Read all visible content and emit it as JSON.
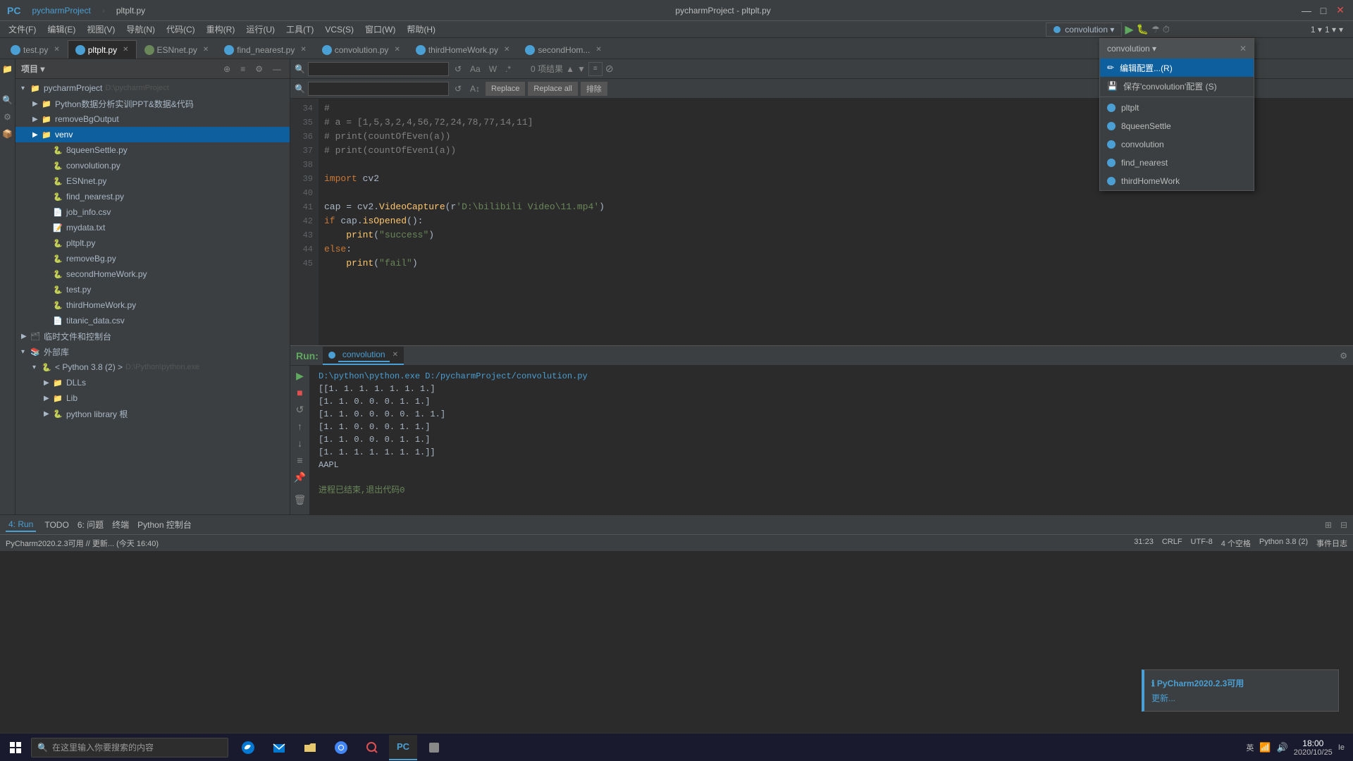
{
  "titlebar": {
    "menu_items": [
      "文件(F)",
      "编辑(E)",
      "视图(V)",
      "导航(N)",
      "代码(C)",
      "重构(R)",
      "运行(U)",
      "工具(T)",
      "VCS(S)",
      "窗口(W)",
      "帮助(H)"
    ],
    "title": "pycharmProject - pltplt.py",
    "btn_min": "—",
    "btn_max": "□",
    "btn_close": "✕"
  },
  "tabs": [
    {
      "label": "test.py",
      "active": false
    },
    {
      "label": "pltplt.py",
      "active": true
    },
    {
      "label": "ESNnet.py",
      "active": false
    },
    {
      "label": "find_nearest.py",
      "active": false
    },
    {
      "label": "convolution.py",
      "active": false
    },
    {
      "label": "thirdHomeWork.py",
      "active": false
    },
    {
      "label": "secondHom...",
      "active": false
    }
  ],
  "project": {
    "title": "项目 ▾",
    "root": "pycharmProject",
    "root_path": "D:\\pycharmProject",
    "items": [
      {
        "name": "Python数据分析实训PPT&数据&代码",
        "type": "folder",
        "indent": 1
      },
      {
        "name": "removeBgOutput",
        "type": "folder",
        "indent": 1
      },
      {
        "name": "venv",
        "type": "folder",
        "indent": 1,
        "selected": true
      },
      {
        "name": "8queenSettle.py",
        "type": "py",
        "indent": 2
      },
      {
        "name": "convolution.py",
        "type": "py",
        "indent": 2
      },
      {
        "name": "ESNnet.py",
        "type": "py",
        "indent": 2
      },
      {
        "name": "find_nearest.py",
        "type": "py",
        "indent": 2
      },
      {
        "name": "job_info.csv",
        "type": "csv",
        "indent": 2
      },
      {
        "name": "mydata.txt",
        "type": "txt",
        "indent": 2
      },
      {
        "name": "pltplt.py",
        "type": "py",
        "indent": 2
      },
      {
        "name": "removeBg.py",
        "type": "py",
        "indent": 2
      },
      {
        "name": "secondHomeWork.py",
        "type": "py",
        "indent": 2
      },
      {
        "name": "test.py",
        "type": "py",
        "indent": 2
      },
      {
        "name": "thirdHomeWork.py",
        "type": "py",
        "indent": 2
      },
      {
        "name": "titanic_data.csv",
        "type": "csv",
        "indent": 2
      },
      {
        "name": "临时文件和控制台",
        "type": "folder",
        "indent": 0
      },
      {
        "name": "外部库",
        "type": "folder",
        "indent": 0
      },
      {
        "name": "< Python 3.8 (2) >",
        "type": "python",
        "indent": 1,
        "path": "D:\\Python\\python.exe"
      },
      {
        "name": "DLLs",
        "type": "folder",
        "indent": 2
      },
      {
        "name": "Lib",
        "type": "folder",
        "indent": 2
      },
      {
        "name": "python library 根",
        "type": "folder",
        "indent": 2
      }
    ]
  },
  "search": {
    "placeholder1": "",
    "placeholder2": "",
    "result": "0 项结果",
    "replace_btn": "Replace",
    "replace_all_btn": "Replace all",
    "remove_btn": "排除"
  },
  "code": {
    "lines": [
      {
        "num": 34,
        "text": "#"
      },
      {
        "num": 35,
        "text": "# a = [1,5,3,2,4,56,72,24,78,77,14,11]"
      },
      {
        "num": 36,
        "text": "# print(countOfEven(a))"
      },
      {
        "num": 37,
        "text": "# print(countOfEven1(a))"
      },
      {
        "num": 38,
        "text": ""
      },
      {
        "num": 39,
        "text": "import cv2"
      },
      {
        "num": 40,
        "text": ""
      },
      {
        "num": 41,
        "text": "cap = cv2.VideoCapture(r'D:\\bilibili Video\\11.mp4')"
      },
      {
        "num": 42,
        "text": "if cap.isOpened():"
      },
      {
        "num": 43,
        "text": "    print(\"success\")"
      },
      {
        "num": 44,
        "text": "else:"
      },
      {
        "num": 45,
        "text": "    print(\"fail\")"
      }
    ]
  },
  "run": {
    "tab_label": "convolution",
    "command": "D:\\python\\python.exe D:/pycharmProject/convolution.py",
    "output_lines": [
      "[[1. 1. 1. 1. 1. 1. 1.]",
      " [1. 1. 0. 0. 0. 1. 1.]",
      " [1. 1. 0. 0. 0. 0. 1. 1.]",
      " [1. 1. 0. 0. 0. 1. 1.]",
      " [1. 1. 0. 0. 0. 1. 1.]",
      " [1. 1. 1. 1. 1. 1. 1.]]",
      "AAPL"
    ],
    "done_text": "进程已结束,退出代码0"
  },
  "bottom_tabs": [
    "4: Run",
    "TODO",
    "6: 问题",
    "终端",
    "Python 控制台"
  ],
  "statusbar": {
    "left": "PyCharm2020.2.3可用 // 更新... (今天 16:40)",
    "pos": "31:23",
    "encoding": "CRLF",
    "charset": "UTF-8",
    "indent": "4 个空格",
    "python": "Python 3.8 (2)",
    "events": "事件日志"
  },
  "dropdown": {
    "header": "convolution ▾",
    "edit_label": "编辑配置...(R)",
    "save_label": "保存'convolution'配置 (S)",
    "items": [
      {
        "label": "pltplt",
        "color": "blue"
      },
      {
        "label": "8queenSettle",
        "color": "blue"
      },
      {
        "label": "convolution",
        "color": "blue"
      },
      {
        "label": "find_nearest",
        "color": "blue"
      },
      {
        "label": "thirdHomeWork",
        "color": "blue"
      }
    ]
  },
  "notification": {
    "title": "ℹ PyCharm2020.2.3可用",
    "link": "更新..."
  },
  "taskbar": {
    "search_placeholder": "在这里输入你要搜索的内容",
    "time": "18:00",
    "date": "2020/10/25",
    "lang": "英"
  },
  "breadcrumb": "pycharmProject",
  "project_label": "项目"
}
